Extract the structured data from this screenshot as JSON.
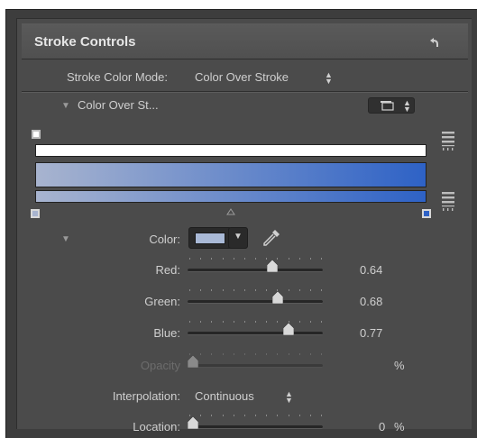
{
  "panel": {
    "title": "Stroke Controls"
  },
  "stroke_color_mode": {
    "label": "Stroke Color Mode:",
    "value": "Color Over Stroke"
  },
  "gradient_section": {
    "label": "Color Over St...",
    "start_color": "#a8b4cf",
    "end_color": "#2e62c6"
  },
  "color_row": {
    "label": "Color:",
    "swatch_color": "#a9b9d6"
  },
  "red": {
    "label": "Red:",
    "value": "0.64",
    "level": 0.64
  },
  "green": {
    "label": "Green:",
    "value": "0.68",
    "level": 0.68
  },
  "blue": {
    "label": "Blue:",
    "value": "0.77",
    "level": 0.77
  },
  "opacity": {
    "label": "Opacity",
    "unit": "%"
  },
  "interpolation": {
    "label": "Interpolation:",
    "value": "Continuous"
  },
  "location": {
    "label": "Location:",
    "value": "0",
    "unit": "%",
    "level": 0
  }
}
